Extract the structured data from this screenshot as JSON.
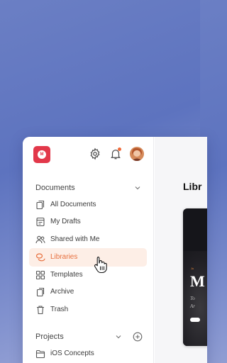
{
  "sidebar": {
    "sections": [
      {
        "title": "Documents",
        "items": [
          {
            "label": "All Documents",
            "icon": "document-stack-icon"
          },
          {
            "label": "My Drafts",
            "icon": "draft-icon"
          },
          {
            "label": "Shared with Me",
            "icon": "users-icon"
          },
          {
            "label": "Libraries",
            "icon": "libraries-icon",
            "active": true
          },
          {
            "label": "Templates",
            "icon": "templates-icon"
          },
          {
            "label": "Archive",
            "icon": "archive-icon"
          },
          {
            "label": "Trash",
            "icon": "trash-icon"
          }
        ]
      },
      {
        "title": "Projects",
        "items": [
          {
            "label": "iOS Concepts",
            "icon": "folder-icon"
          }
        ]
      }
    ]
  },
  "main": {
    "title": "Libr",
    "card": {
      "tag": "Ju",
      "big": "M",
      "sub1": "To",
      "sub2": "Ar"
    }
  },
  "colors": {
    "accent": "#e76f3d",
    "logo": "#e2384a",
    "active_bg": "#fdeee6"
  }
}
